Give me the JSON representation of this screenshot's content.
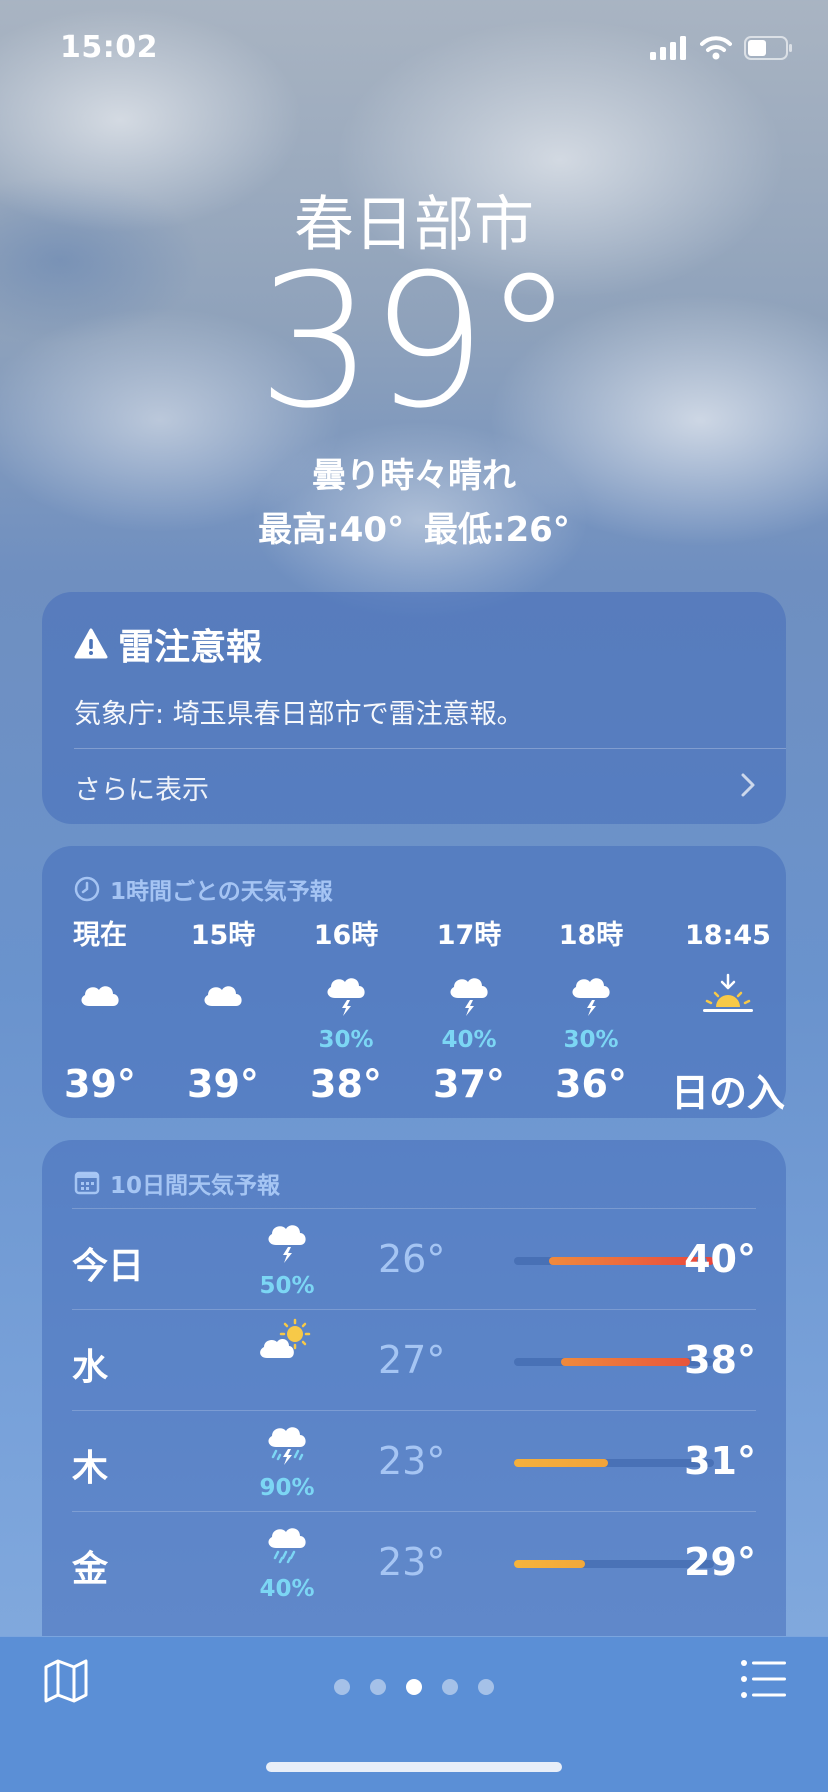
{
  "status": {
    "time": "15:02"
  },
  "header": {
    "city": "春日部市",
    "temperature": "39°",
    "condition": "曇り時々晴れ",
    "high_low": "最高:40° 最低:26°"
  },
  "alert": {
    "title": "雷注意報",
    "text": "気象庁: 埼玉県春日部市で雷注意報。",
    "more": "さらに表示",
    "icon": "warning-icon"
  },
  "hourly": {
    "header": "1時間ごとの天気予報",
    "items": [
      {
        "label": "現在",
        "icon": "cloud-icon",
        "pop": "",
        "temp": "39°"
      },
      {
        "label": "15時",
        "icon": "cloud-icon",
        "pop": "",
        "temp": "39°"
      },
      {
        "label": "16時",
        "icon": "thunder-cloud-icon",
        "pop": "30%",
        "temp": "38°"
      },
      {
        "label": "17時",
        "icon": "thunder-cloud-icon",
        "pop": "40%",
        "temp": "37°"
      },
      {
        "label": "18時",
        "icon": "thunder-cloud-icon",
        "pop": "30%",
        "temp": "36°"
      },
      {
        "label": "18:45",
        "icon": "sunset-icon",
        "pop": "",
        "temp": "日の入"
      }
    ]
  },
  "daily": {
    "header": "10日間天気予報",
    "range_min": 23,
    "range_max": 40,
    "items": [
      {
        "day": "今日",
        "icon": "thunder-cloud-icon",
        "pop": "50%",
        "low": "26°",
        "high": "40°",
        "low_val": 26,
        "high_val": 40,
        "current": 39,
        "color_from": "#f08a3c",
        "color_to": "#e8453c"
      },
      {
        "day": "水",
        "icon": "partly-sunny-icon",
        "pop": "",
        "low": "27°",
        "high": "38°",
        "low_val": 27,
        "high_val": 38,
        "color_from": "#f08a3c",
        "color_to": "#e8553c"
      },
      {
        "day": "木",
        "icon": "thunder-rain-icon",
        "pop": "90%",
        "low": "23°",
        "high": "31°",
        "low_val": 23,
        "high_val": 31,
        "color_from": "#f5b03c",
        "color_to": "#f2a33a"
      },
      {
        "day": "金",
        "icon": "rain-cloud-icon",
        "pop": "40%",
        "low": "23°",
        "high": "29°",
        "low_val": 23,
        "high_val": 29,
        "color_from": "#f5b43c",
        "color_to": "#f2a83a"
      }
    ]
  },
  "pager": {
    "count": 5,
    "active": 2
  }
}
